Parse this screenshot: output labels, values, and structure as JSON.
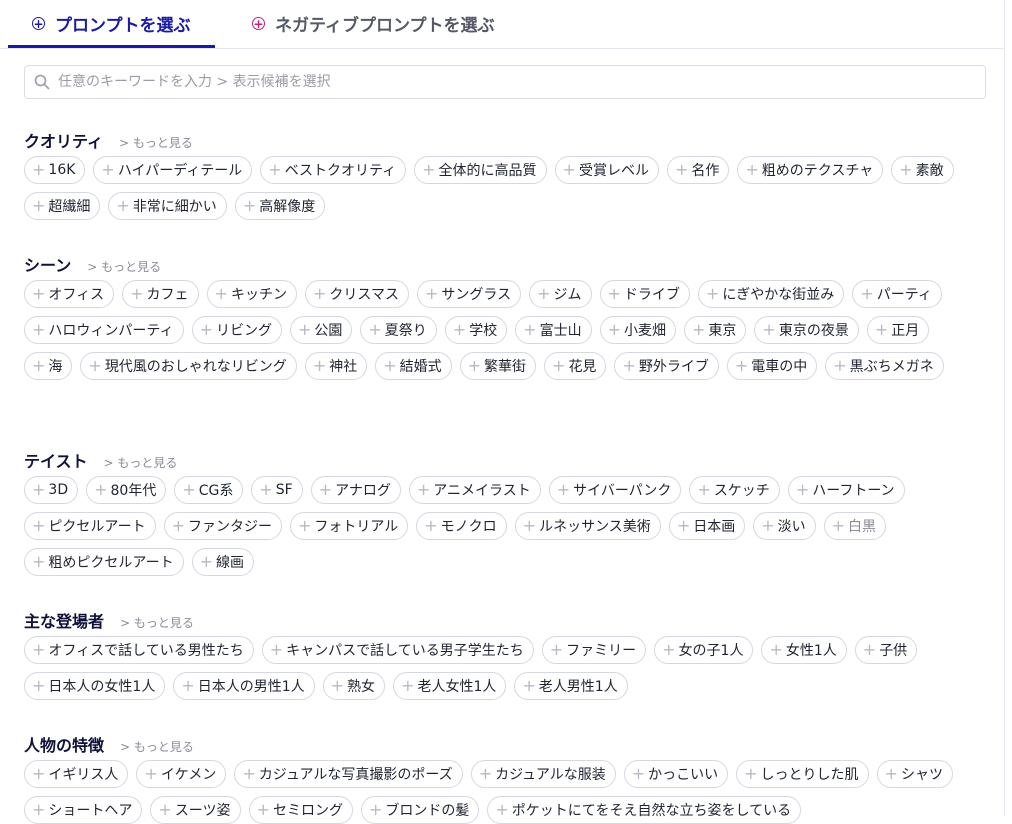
{
  "tabs": [
    {
      "label": "プロンプトを選ぶ",
      "icon": "plus-circle-icon",
      "active": true,
      "accent": "#1a1aa6"
    },
    {
      "label": "ネガティブプロンプトを選ぶ",
      "icon": "plus-circle-icon",
      "active": false,
      "accent": "#c6227a"
    }
  ],
  "search": {
    "placeholder": "任意のキーワードを入力 > 表示候補を選択",
    "value": ""
  },
  "more_label": "> もっと見る",
  "sections": [
    {
      "title": "クオリティ",
      "chips": [
        "16K",
        "ハイパーディテール",
        "ベストクオリティ",
        "全体的に高品質",
        "受賞レベル",
        "名作",
        "粗めのテクスチャ",
        "素敵",
        "超繊細",
        "非常に細かい",
        "高解像度"
      ]
    },
    {
      "title": "シーン",
      "chips": [
        "オフィス",
        "カフェ",
        "キッチン",
        "クリスマス",
        "サングラス",
        "ジム",
        "ドライブ",
        "にぎやかな街並み",
        "パーティ",
        "ハロウィンパーティ",
        "リビング",
        "公園",
        "夏祭り",
        "学校",
        "富士山",
        "小麦畑",
        "東京",
        "東京の夜景",
        "正月",
        "海",
        "現代風のおしゃれなリビング",
        "神社",
        "結婚式",
        "繁華街",
        "花見",
        "野外ライブ",
        "電車の中",
        "黒ぶちメガネ"
      ]
    },
    {
      "title": "テイスト",
      "chips": [
        "3D",
        "80年代",
        "CG系",
        "SF",
        "アナログ",
        "アニメイラスト",
        "サイバーパンク",
        "スケッチ",
        "ハーフトーン",
        "ピクセルアート",
        "ファンタジー",
        "フォトリアル",
        "モノクロ",
        "ルネッサンス美術",
        "日本画",
        "淡い",
        "白黒",
        "粗めピクセルアート",
        "線画"
      ]
    },
    {
      "title": "主な登場者",
      "chips": [
        "オフィスで話している男性たち",
        "キャンパスで話している男子学生たち",
        "ファミリー",
        "女の子1人",
        "女性1人",
        "子供",
        "日本人の女性1人",
        "日本人の男性1人",
        "熟女",
        "老人女性1人",
        "老人男性1人"
      ]
    },
    {
      "title": "人物の特徴",
      "chips": [
        "イギリス人",
        "イケメン",
        "カジュアルな写真撮影のポーズ",
        "カジュアルな服装",
        "かっこいい",
        "しっとりした肌",
        "シャツ",
        "ショートヘア",
        "スーツ姿",
        "セミロング",
        "ブロンドの髪",
        "ポケットにてをそえ自然な立ち姿をしている"
      ]
    }
  ],
  "muted_chip": "白黒"
}
